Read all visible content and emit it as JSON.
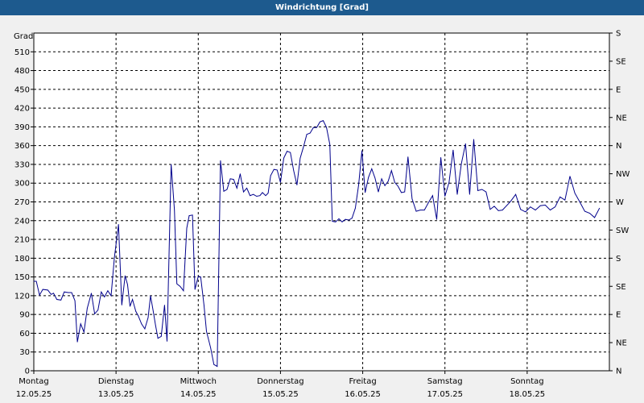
{
  "window": {
    "title": "Windrichtung [Grad]"
  },
  "chart_data": {
    "type": "line",
    "title": "Windrichtung [Grad]",
    "ylabel": "Grad",
    "ylim": [
      0,
      540
    ],
    "y_ticks": [
      0,
      30,
      60,
      90,
      120,
      150,
      180,
      210,
      240,
      270,
      300,
      330,
      360,
      390,
      420,
      450,
      480,
      510
    ],
    "right_ticks": [
      {
        "value": 0,
        "label": "N"
      },
      {
        "value": 45,
        "label": "NE"
      },
      {
        "value": 90,
        "label": "E"
      },
      {
        "value": 135,
        "label": "SE"
      },
      {
        "value": 180,
        "label": "S"
      },
      {
        "value": 225,
        "label": "SW"
      },
      {
        "value": 270,
        "label": "W"
      },
      {
        "value": 315,
        "label": "NW"
      },
      {
        "value": 360,
        "label": "N"
      },
      {
        "value": 405,
        "label": "NE"
      },
      {
        "value": 450,
        "label": "E"
      },
      {
        "value": 495,
        "label": "SE"
      },
      {
        "value": 540,
        "label": "S"
      }
    ],
    "x_ticks": [
      {
        "value": 0,
        "day": "Montag",
        "date": "12.05.25"
      },
      {
        "value": 1,
        "day": "Dienstag",
        "date": "13.05.25"
      },
      {
        "value": 2,
        "day": "Mittwoch",
        "date": "14.05.25"
      },
      {
        "value": 3,
        "day": "Donnerstag",
        "date": "15.05.25"
      },
      {
        "value": 4,
        "day": "Freitag",
        "date": "16.05.25"
      },
      {
        "value": 5,
        "day": "Samstag",
        "date": "17.05.25"
      },
      {
        "value": 6,
        "day": "Sonntag",
        "date": "18.05.25"
      }
    ],
    "xlim": [
      0,
      7
    ],
    "grid": true,
    "series": [
      {
        "values": [
          [
            0,
            143
          ],
          [
            0.03,
            143
          ],
          [
            0.07,
            121
          ],
          [
            0.11,
            130
          ],
          [
            0.17,
            129
          ],
          [
            0.21,
            122
          ],
          [
            0.24,
            124
          ],
          [
            0.28,
            114
          ],
          [
            0.33,
            113
          ],
          [
            0.37,
            126
          ],
          [
            0.42,
            125
          ],
          [
            0.46,
            125
          ],
          [
            0.5,
            112
          ],
          [
            0.53,
            46
          ],
          [
            0.57,
            75
          ],
          [
            0.61,
            62
          ],
          [
            0.65,
            100
          ],
          [
            0.7,
            124
          ],
          [
            0.74,
            91
          ],
          [
            0.78,
            97
          ],
          [
            0.82,
            126
          ],
          [
            0.86,
            118
          ],
          [
            0.9,
            128
          ],
          [
            0.94,
            120
          ],
          [
            0.98,
            181
          ],
          [
            1.03,
            234
          ],
          [
            1.07,
            105
          ],
          [
            1.11,
            152
          ],
          [
            1.14,
            138
          ],
          [
            1.17,
            103
          ],
          [
            1.2,
            114
          ],
          [
            1.24,
            95
          ],
          [
            1.27,
            88
          ],
          [
            1.31,
            75
          ],
          [
            1.35,
            67
          ],
          [
            1.39,
            85
          ],
          [
            1.42,
            120
          ],
          [
            1.45,
            97
          ],
          [
            1.48,
            73
          ],
          [
            1.51,
            52
          ],
          [
            1.55,
            55
          ],
          [
            1.59,
            105
          ],
          [
            1.62,
            47
          ],
          [
            1.67,
            330
          ],
          [
            1.71,
            257
          ],
          [
            1.74,
            139
          ],
          [
            1.78,
            135
          ],
          [
            1.82,
            128
          ],
          [
            1.86,
            228
          ],
          [
            1.89,
            248
          ],
          [
            1.93,
            249
          ],
          [
            1.96,
            130
          ],
          [
            2.0,
            151
          ],
          [
            2.03,
            150
          ],
          [
            2.07,
            105
          ],
          [
            2.1,
            63
          ],
          [
            2.15,
            37
          ],
          [
            2.19,
            10
          ],
          [
            2.23,
            7
          ],
          [
            2.27,
            336
          ],
          [
            2.31,
            287
          ],
          [
            2.35,
            290
          ],
          [
            2.39,
            307
          ],
          [
            2.43,
            306
          ],
          [
            2.47,
            292
          ],
          [
            2.51,
            315
          ],
          [
            2.55,
            286
          ],
          [
            2.59,
            292
          ],
          [
            2.63,
            280
          ],
          [
            2.67,
            282
          ],
          [
            2.71,
            279
          ],
          [
            2.75,
            280
          ],
          [
            2.78,
            285
          ],
          [
            2.82,
            280
          ],
          [
            2.85,
            284
          ],
          [
            2.88,
            312
          ],
          [
            2.92,
            322
          ],
          [
            2.96,
            321
          ],
          [
            3.0,
            301
          ],
          [
            3.04,
            340
          ],
          [
            3.08,
            351
          ],
          [
            3.12,
            349
          ],
          [
            3.16,
            320
          ],
          [
            3.2,
            297
          ],
          [
            3.24,
            340
          ],
          [
            3.28,
            358
          ],
          [
            3.32,
            378
          ],
          [
            3.36,
            380
          ],
          [
            3.4,
            389
          ],
          [
            3.44,
            389
          ],
          [
            3.48,
            398
          ],
          [
            3.52,
            400
          ],
          [
            3.56,
            389
          ],
          [
            3.6,
            362
          ],
          [
            3.63,
            239
          ],
          [
            3.67,
            238
          ],
          [
            3.71,
            243
          ],
          [
            3.75,
            238
          ],
          [
            3.79,
            242
          ],
          [
            3.83,
            241
          ],
          [
            3.87,
            244
          ],
          [
            3.91,
            260
          ],
          [
            3.95,
            297
          ],
          [
            3.99,
            352
          ],
          [
            4.03,
            285
          ],
          [
            4.07,
            309
          ],
          [
            4.11,
            323
          ],
          [
            4.15,
            308
          ],
          [
            4.19,
            286
          ],
          [
            4.23,
            307
          ],
          [
            4.27,
            296
          ],
          [
            4.31,
            303
          ],
          [
            4.35,
            320
          ],
          [
            4.39,
            301
          ],
          [
            4.43,
            295
          ],
          [
            4.47,
            285
          ],
          [
            4.51,
            286
          ],
          [
            4.55,
            342
          ],
          [
            4.6,
            275
          ],
          [
            4.65,
            255
          ],
          [
            4.7,
            257
          ],
          [
            4.75,
            257
          ],
          [
            4.8,
            269
          ],
          [
            4.85,
            280
          ],
          [
            4.9,
            242
          ],
          [
            4.95,
            341
          ],
          [
            5.0,
            279
          ],
          [
            5.05,
            301
          ],
          [
            5.1,
            353
          ],
          [
            5.15,
            282
          ],
          [
            5.2,
            331
          ],
          [
            5.25,
            363
          ],
          [
            5.3,
            282
          ],
          [
            5.35,
            370
          ],
          [
            5.4,
            288
          ],
          [
            5.45,
            290
          ],
          [
            5.5,
            286
          ],
          [
            5.55,
            258
          ],
          [
            5.6,
            263
          ],
          [
            5.65,
            256
          ],
          [
            5.7,
            257
          ],
          [
            5.75,
            264
          ],
          [
            5.8,
            271
          ],
          [
            5.86,
            282
          ],
          [
            5.92,
            258
          ],
          [
            5.98,
            254
          ],
          [
            6.04,
            262
          ],
          [
            6.1,
            257
          ],
          [
            6.16,
            264
          ],
          [
            6.22,
            265
          ],
          [
            6.28,
            257
          ],
          [
            6.34,
            262
          ],
          [
            6.4,
            278
          ],
          [
            6.46,
            273
          ],
          [
            6.52,
            311
          ],
          [
            6.58,
            284
          ],
          [
            6.64,
            270
          ],
          [
            6.7,
            255
          ],
          [
            6.76,
            252
          ],
          [
            6.82,
            245
          ],
          [
            6.88,
            260
          ]
        ]
      }
    ]
  }
}
